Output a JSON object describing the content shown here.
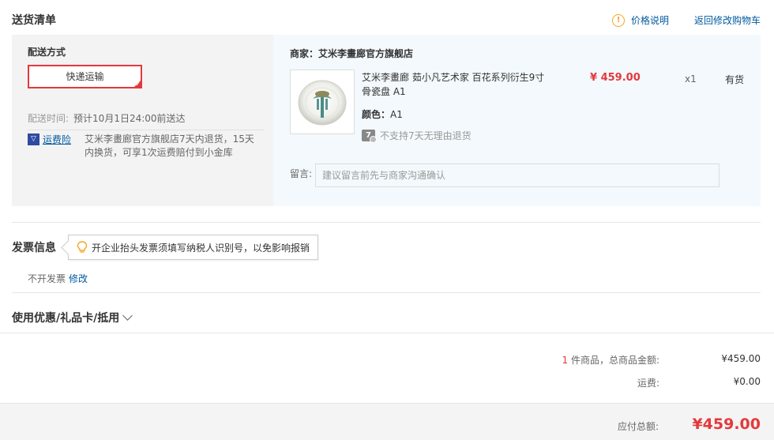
{
  "header": {
    "title": "送货清单",
    "price_info": "价格说明",
    "back_to_cart": "返回修改购物车"
  },
  "shipping": {
    "method_label": "配送方式",
    "method_option": "快递运输",
    "time_label": "配送时间:",
    "time_value": "预计10月1日24:00前送达",
    "insurance_link": "运费险",
    "insurance_text": "艾米李畫廊官方旗舰店7天内退货，15天内换货，可享1次运费赔付到小金库"
  },
  "product": {
    "shop_name": "商家：艾米李畫廊官方旗舰店",
    "name": "艾米李畫廊 茹小凡艺术家 百花系列衍生9寸骨瓷盘 A1",
    "price": "¥ 459.00",
    "qty": "x1",
    "stock": "有货",
    "color_label": "颜色：",
    "color_value": "A1",
    "no_return": "不支持7天无理由退货",
    "no_return_icon": "7",
    "message_label": "留言:",
    "message_placeholder": "建议留言前先与商家沟通确认"
  },
  "invoice": {
    "title": "发票信息",
    "tip": "开企业抬头发票须填写纳税人识别号，以免影响报销",
    "value": "不开发票",
    "edit": "修改"
  },
  "coupon": {
    "title": "使用优惠/礼品卡/抵用"
  },
  "summary": {
    "count": "1",
    "items_label": " 件商品，总商品金额:",
    "items_total": "¥459.00",
    "shipping_label": "运费:",
    "shipping_fee": "¥0.00",
    "payable_label": "应付总额:",
    "payable_total": "¥459.00"
  },
  "colors": {
    "accent_red": "#e4393c",
    "link_blue": "#005aa0",
    "warning_orange": "#f5a623"
  }
}
